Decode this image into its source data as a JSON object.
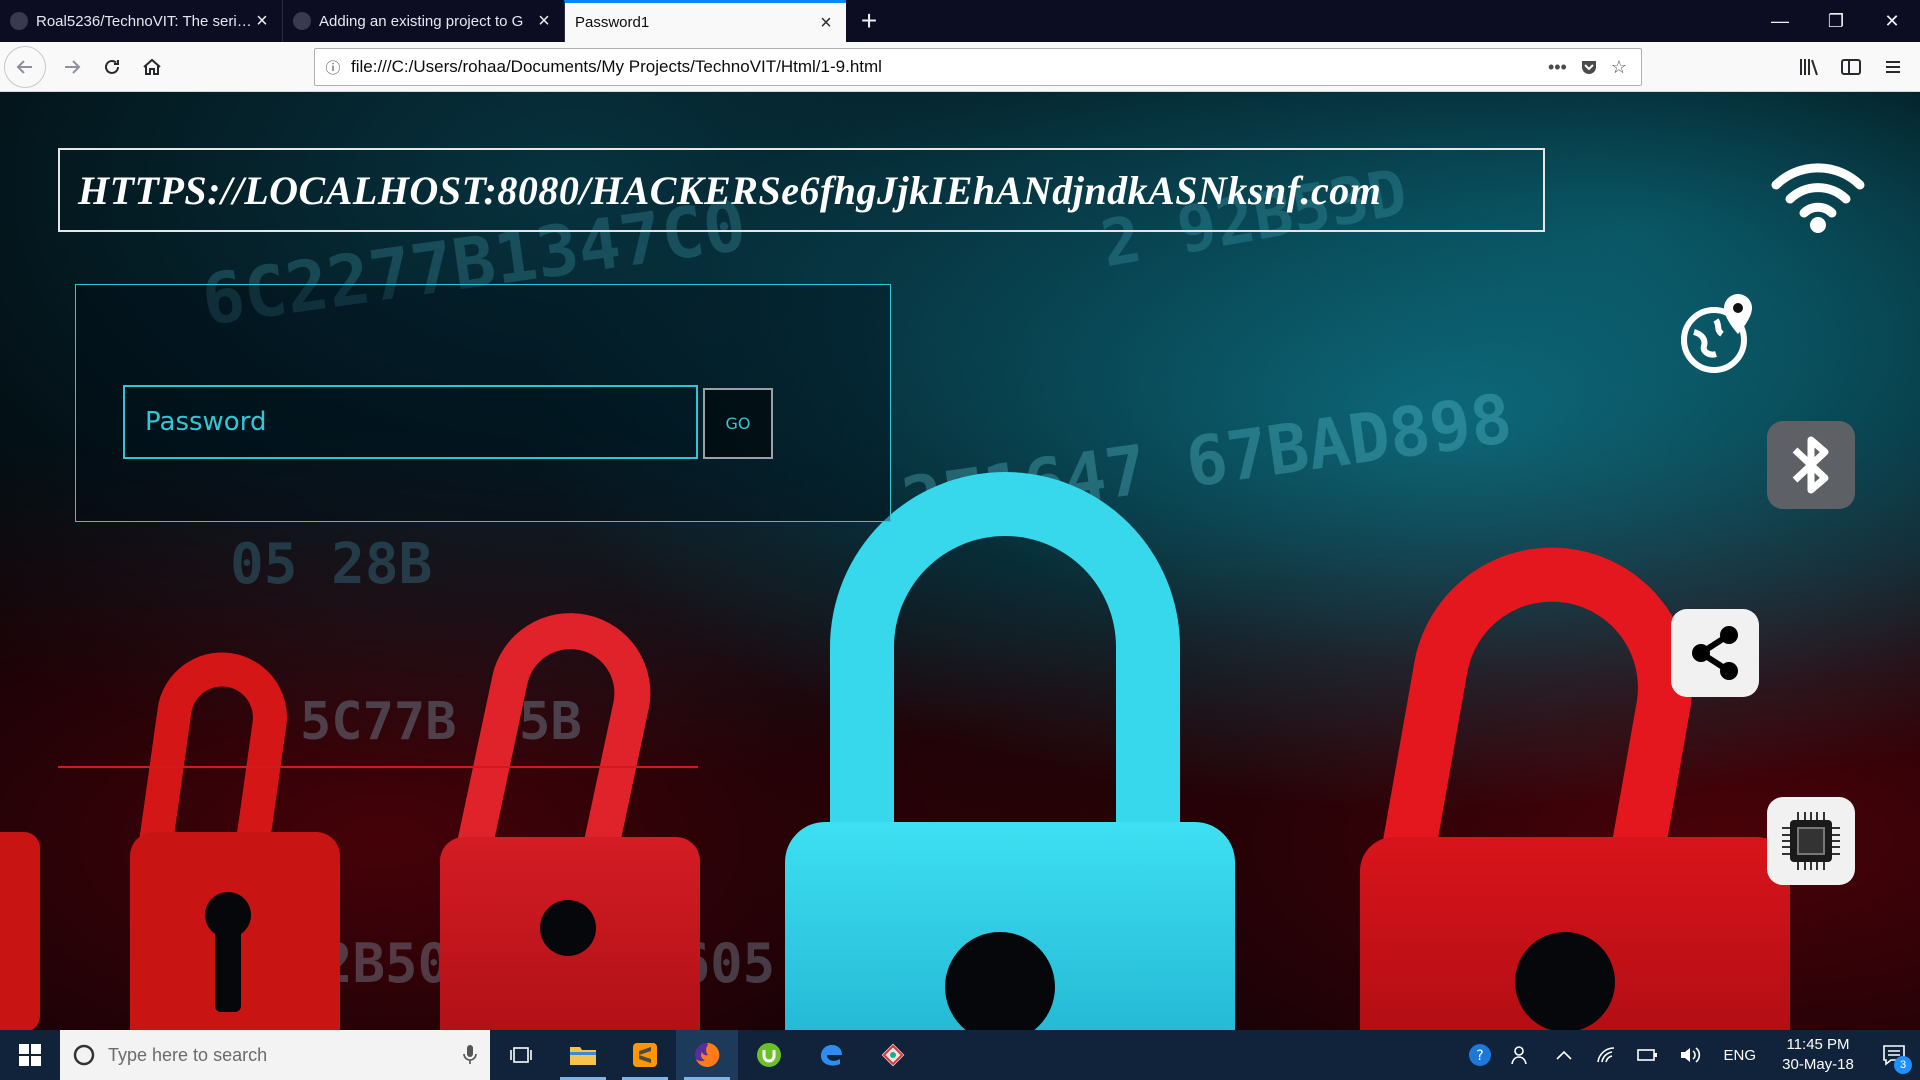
{
  "browser": {
    "tabs": [
      {
        "label": "Roal5236/TechnoVIT: The series",
        "active": false
      },
      {
        "label": "Adding an existing project to G",
        "active": false
      },
      {
        "label": "Password1",
        "active": true
      }
    ],
    "new_tab_symbol": "+",
    "window_controls": {
      "minimize": "—",
      "restore": "❐",
      "close": "✕"
    },
    "url": "file:///C:/Users/rohaa/Documents/My Projects/TechnoVIT/Html/1-9.html",
    "url_icons": [
      "info-icon",
      "more-icon",
      "pocket-icon",
      "star-icon"
    ],
    "toolbar_icons": [
      "library-icon",
      "sidebar-icon",
      "menu-icon"
    ]
  },
  "page": {
    "title_url": "HTTPS://LOCALHOST:8080/HACKERSe6fhgJjkIEhANdjndkASNksnf.com",
    "password": {
      "placeholder": "Password",
      "value": ""
    },
    "go_label": "GO",
    "background_hex": {
      "row1": "6C2277B1347C0",
      "row2": "2  92B53D",
      "row3": "2F1647 67BAD898",
      "row4": "05 28B",
      "row5": "5C77B 25B",
      "row6": "2B5095BFBC5605"
    },
    "side_icons": [
      "wifi-icon",
      "globe-location-icon",
      "bluetooth-icon",
      "share-icon",
      "chip-icon"
    ]
  },
  "taskbar": {
    "search_placeholder": "Type here to search",
    "apps": [
      "task-view-icon",
      "file-explorer-icon",
      "sublime-text-icon",
      "firefox-icon",
      "utorrent-icon",
      "edge-icon",
      "git-icon"
    ],
    "language": "ENG",
    "time": "11:45 PM",
    "date": "30-May-18",
    "notification_count": "3"
  },
  "colors": {
    "accent_cyan": "#31c4d3",
    "lock_red": "#d51616",
    "lock_cyan": "#38d8ec",
    "taskbar": "#10233b"
  }
}
